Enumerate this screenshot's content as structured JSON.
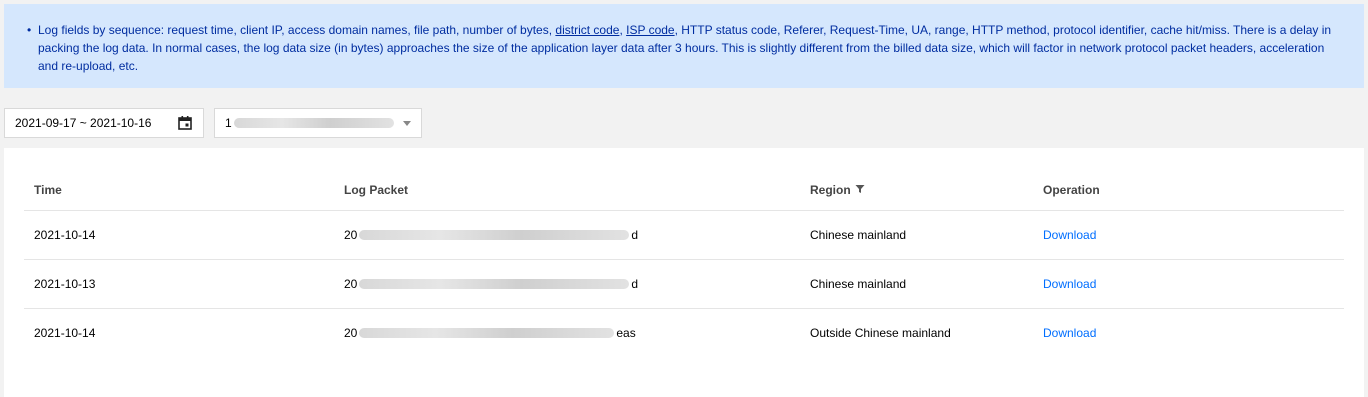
{
  "notice": {
    "bullet": "•",
    "text_1": "Log fields by sequence: request time, client IP, access domain names, file path, number of bytes, ",
    "link_district": "district code",
    "text_2": ", ",
    "link_isp": "ISP code",
    "text_3": ", HTTP status code, Referer, Request-Time, UA, range, HTTP method, protocol identifier, cache hit/miss. There is a delay in packing the log data. In normal cases, the log data size (in bytes) approaches the size of the application layer data after 3 hours. This is slightly different from the billed data size, which will factor in network protocol packet headers, acceleration and re-upload, etc."
  },
  "filters": {
    "date_range": "2021-09-17 ~ 2021-10-16",
    "domain_select_prefix": "1"
  },
  "table": {
    "headers": {
      "time": "Time",
      "log_packet": "Log Packet",
      "region": "Region",
      "operation": "Operation"
    },
    "rows": [
      {
        "time": "2021-10-14",
        "packet_prefix": "20",
        "packet_suffix": "d",
        "region": "Chinese mainland",
        "action": "Download"
      },
      {
        "time": "2021-10-13",
        "packet_prefix": "20",
        "packet_suffix": "d",
        "region": "Chinese mainland",
        "action": "Download"
      },
      {
        "time": "2021-10-14",
        "packet_prefix": "20",
        "packet_suffix": "eas",
        "region": "Outside Chinese mainland",
        "action": "Download"
      }
    ]
  },
  "icons": {
    "calendar": "calendar-icon",
    "filter": "filter-icon",
    "dropdown": "chevron-down-icon"
  },
  "colors": {
    "notice_bg": "#d5e7fd",
    "notice_text": "#002da0",
    "link": "#006eff"
  }
}
